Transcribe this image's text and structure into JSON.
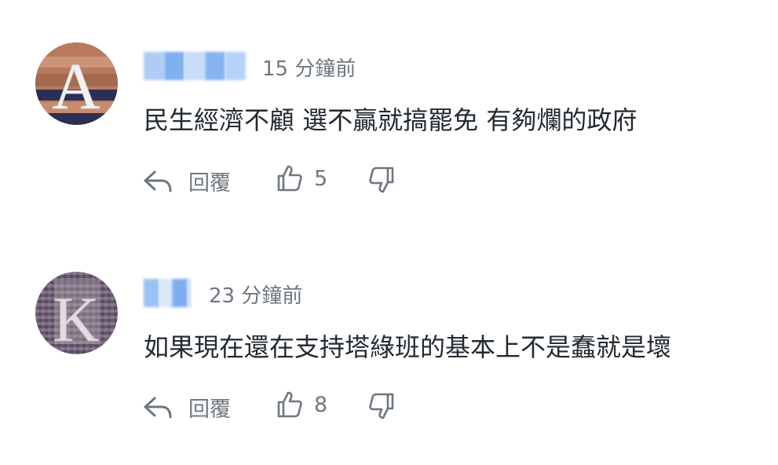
{
  "comments": [
    {
      "avatar_letter": "A",
      "username": "",
      "time": "15 分鐘前",
      "text": "民生經濟不顧 選不贏就搞罷免 有夠爛的政府",
      "reply_label": "回覆",
      "like_count": "5"
    },
    {
      "avatar_letter": "K",
      "username": "",
      "time": "23 分鐘前",
      "text": "如果現在還在支持塔綠班的基本上不是蠢就是壞",
      "reply_label": "回覆",
      "like_count": "8"
    }
  ],
  "icons": {
    "reply": "reply-arrow-icon",
    "like": "thumbs-up-icon",
    "dislike": "thumbs-down-icon"
  },
  "colors": {
    "text": "#232a31",
    "meta": "#6e7780",
    "blur": "#8fb8f2"
  }
}
